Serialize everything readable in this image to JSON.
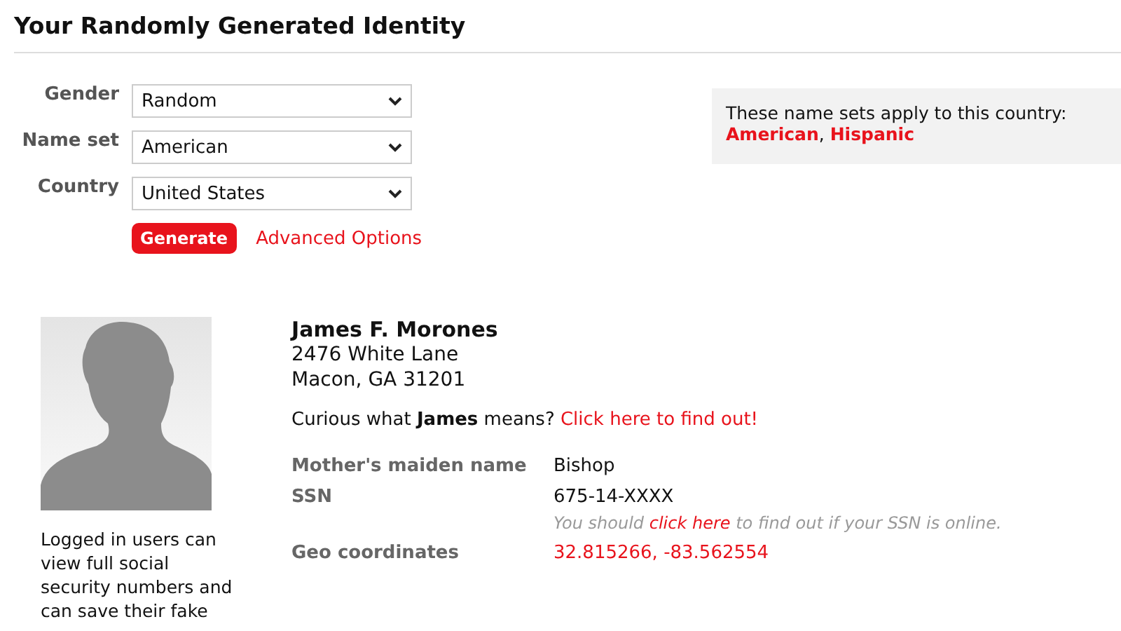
{
  "page_title": "Your Randomly Generated Identity",
  "form": {
    "fields": [
      {
        "label": "Gender",
        "value": "Random"
      },
      {
        "label": "Name set",
        "value": "American"
      },
      {
        "label": "Country",
        "value": "United States"
      }
    ],
    "generate_button": "Generate",
    "advanced_link": "Advanced Options"
  },
  "info_box": {
    "text": "These name sets apply to this country:",
    "name_sets": [
      "American",
      "Hispanic"
    ],
    "separator": ", "
  },
  "profile": {
    "caption": "Logged in users can view full social security numbers and can save their fake",
    "name": "James F. Morones",
    "address_lines": [
      "2476 White Lane",
      "Macon, GA 31201"
    ],
    "meaning": {
      "text": "Curious what **James** means? ",
      "link": "Click here to find out!"
    },
    "details": [
      {
        "label": "Mother's maiden name",
        "value": "Bishop",
        "kind": "text"
      },
      {
        "label": "SSN",
        "value": "675-14-XXXX",
        "kind": "text",
        "note": {
          "before": "You should ",
          "link": "click here",
          "after": " to find out if your SSN is online."
        }
      },
      {
        "label": "Geo coordinates",
        "value": "32.815266, -83.562554",
        "kind": "link"
      }
    ]
  }
}
